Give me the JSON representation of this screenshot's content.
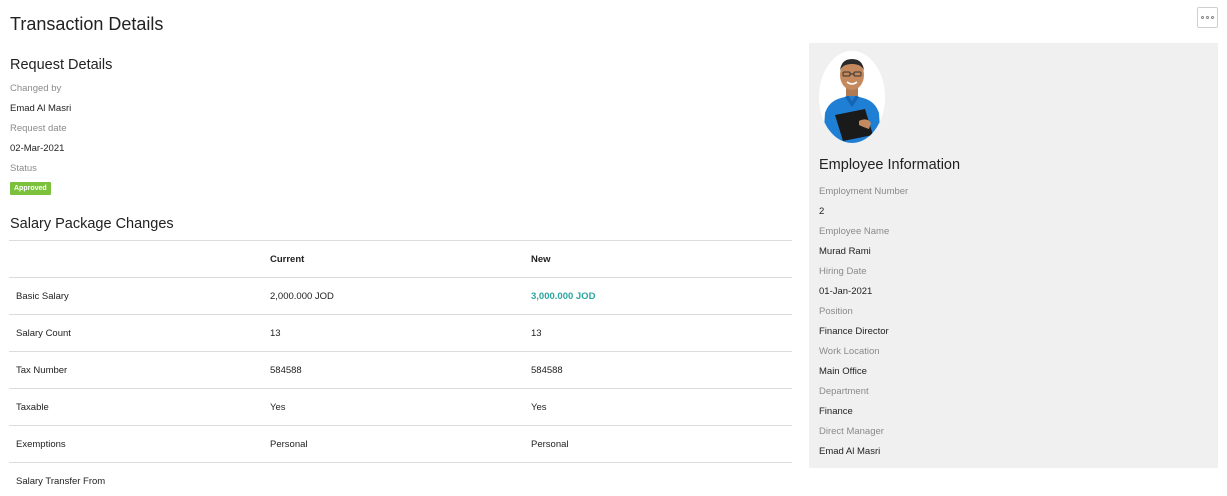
{
  "page": {
    "title": "Transaction Details"
  },
  "request": {
    "title": "Request Details",
    "changed_by_label": "Changed by",
    "changed_by": "Emad Al Masri",
    "request_date_label": "Request date",
    "request_date": "02-Mar-2021",
    "status_label": "Status",
    "status": "Approved",
    "status_color": "#7cc13c"
  },
  "salary": {
    "title": "Salary Package Changes",
    "headers": [
      "",
      "Current",
      "New"
    ],
    "rows": [
      {
        "label": "Basic Salary",
        "current": "2,000.000 JOD",
        "new": "3,000.000 JOD"
      },
      {
        "label": "Salary Count",
        "current": "13",
        "new": "13"
      },
      {
        "label": "Tax Number",
        "current": "584588",
        "new": "584588"
      },
      {
        "label": "Taxable",
        "current": "Yes",
        "new": "Yes"
      },
      {
        "label": "Exemptions",
        "current": "Personal",
        "new": "Personal"
      },
      {
        "label": "Salary Transfer From",
        "current": "",
        "new": ""
      }
    ],
    "changed_color": "#2aa6a0"
  },
  "employee": {
    "title": "Employee Information",
    "fields": [
      {
        "label": "Employment Number",
        "value": "2"
      },
      {
        "label": "Employee Name",
        "value": "Murad Rami"
      },
      {
        "label": "Hiring Date",
        "value": "01-Jan-2021"
      },
      {
        "label": "Position",
        "value": "Finance Director"
      },
      {
        "label": "Work Location",
        "value": "Main Office"
      },
      {
        "label": "Department",
        "value": "Finance"
      },
      {
        "label": "Direct Manager",
        "value": "Emad Al Masri"
      }
    ]
  }
}
